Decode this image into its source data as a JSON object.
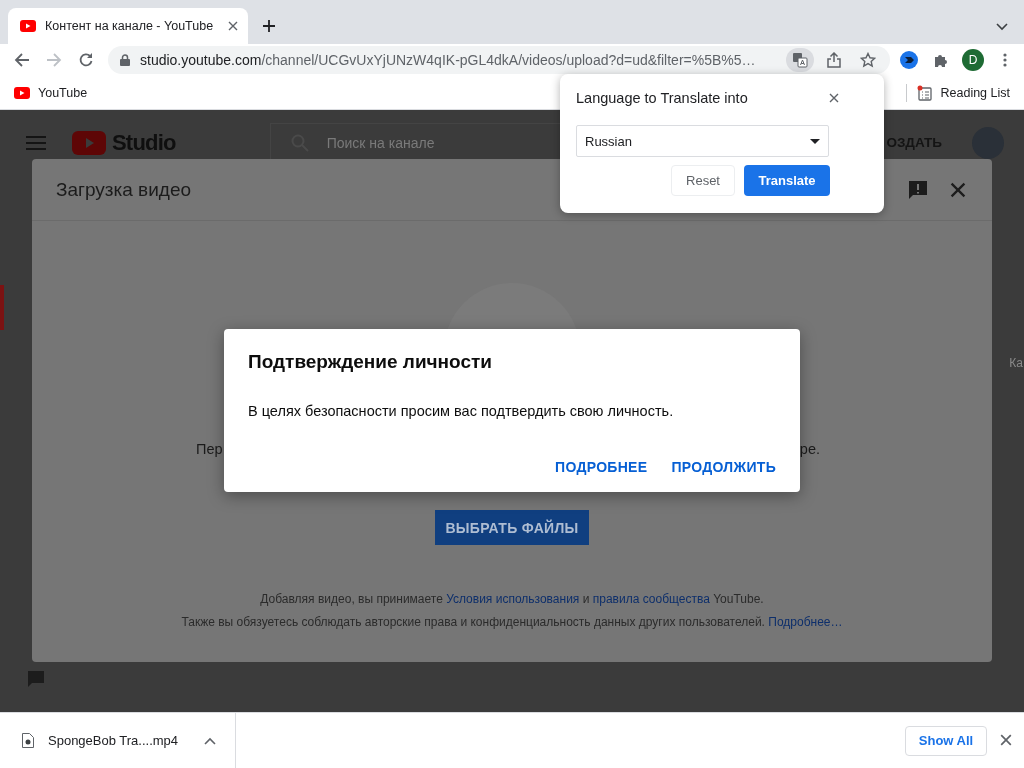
{
  "browser": {
    "tabs": [
      {
        "title": "Контент на канале - YouTube",
        "selected": true
      }
    ],
    "forward": {
      "disabled": true
    },
    "address": {
      "host": "studio.youtube.com",
      "path": "/channel/UCGvUxYjUNzW4qIK-pGL4dkA/videos/upload?d=ud&filter=%5B%5…"
    },
    "translate": {
      "active": true
    },
    "profile": {
      "initial": "D"
    },
    "bookmarks": [
      {
        "label": "YouTube"
      }
    ],
    "reading_list": {
      "label": "Reading List"
    }
  },
  "studio": {
    "logo_text": "Studio",
    "search_placeholder": "Поиск на канале",
    "create_label": "ОЗДАТЬ",
    "edge_text": "Ка"
  },
  "upload_dialog": {
    "title": "Загрузка видео",
    "prompt_start": "Пер",
    "prompt_end": "ре.",
    "select_button": "ВЫБРАТЬ ФАЙЛЫ",
    "notes": [
      [
        {
          "text": "Добавляя видео, вы принимаете ",
          "link": false
        },
        {
          "text": "Условия использования",
          "link": true
        },
        {
          "text": " и ",
          "link": false
        },
        {
          "text": "правила сообщества",
          "link": true
        },
        {
          "text": " YouTube.",
          "link": false
        }
      ],
      [
        {
          "text": "Также вы обязуетесь соблюдать авторские права и конфиденциальность данных других пользователей. ",
          "link": false
        },
        {
          "text": "Подробнее…",
          "link": true
        }
      ]
    ]
  },
  "confirm_dialog": {
    "title": "Подтверждение личности",
    "message": "В целях безопасности просим вас подтвердить свою личность.",
    "buttons": [
      "ПОДРОБНЕЕ",
      "ПРОДОЛЖИТЬ"
    ]
  },
  "translate_popup": {
    "title": "Language to Translate into",
    "language": "Russian",
    "buttons": [
      {
        "label": "Reset",
        "kind": "secondary"
      },
      {
        "label": "Translate",
        "kind": "primary"
      }
    ]
  },
  "downloads": {
    "items": [
      {
        "name": "SpongeBob Tra....mp4"
      }
    ],
    "show_all": "Show All"
  }
}
